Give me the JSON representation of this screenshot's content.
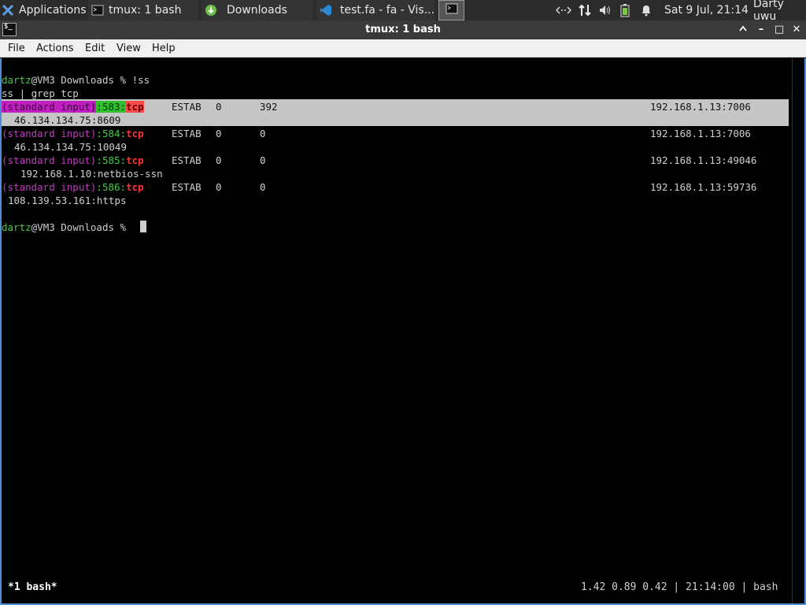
{
  "panel": {
    "apps_label": "Applications",
    "tasks": [
      {
        "label": "tmux: 1 bash"
      },
      {
        "label": "Downloads"
      },
      {
        "label": "test.fa - fa - Vis..."
      }
    ],
    "clock": "Sat  9 Jul, 21:14",
    "user": "Darty uwu"
  },
  "window": {
    "title": "tmux: 1 bash",
    "minimize": "–",
    "maximize": "□",
    "close": "✕"
  },
  "menu": {
    "file": "File",
    "actions": "Actions",
    "edit": "Edit",
    "view": "View",
    "help": "Help"
  },
  "terminal": {
    "prompt_user": "dartz",
    "prompt_rest": "@VM3 Downloads % ",
    "command": "!ss",
    "expanded_command": "ss | grep tcp",
    "rows": [
      {
        "src": "(standard input)",
        "line": "583",
        "proto": "tcp",
        "state": "ESTAB",
        "recvq": "0",
        "sendq": "392",
        "local": "192.168.1.13:7006",
        "peer": "46.134.134.75:8609"
      },
      {
        "src": "(standard input)",
        "line": "584",
        "proto": "tcp",
        "state": "ESTAB",
        "recvq": "0",
        "sendq": "0",
        "local": "192.168.1.13:7006",
        "peer": "46.134.134.75:10049"
      },
      {
        "src": "(standard input)",
        "line": "585",
        "proto": "tcp",
        "state": "ESTAB",
        "recvq": "0",
        "sendq": "0",
        "local": "192.168.1.13:49046",
        "peer": "192.168.1.10:netbios-ssn"
      },
      {
        "src": "(standard input)",
        "line": "586",
        "proto": "tcp",
        "state": "ESTAB",
        "recvq": "0",
        "sendq": "0",
        "local": "192.168.1.13:59736",
        "peer": "108.139.53.161:https"
      }
    ]
  },
  "tmux_status": {
    "window": "*1 bash*",
    "right": "1.42 0.89 0.42 | 21:14:00 | bash"
  },
  "colors": {
    "accent": "#4a90d9",
    "prompt_green": "#3bd13b",
    "grep_magenta": "#c03ac0",
    "grep_red": "#ff3030"
  }
}
